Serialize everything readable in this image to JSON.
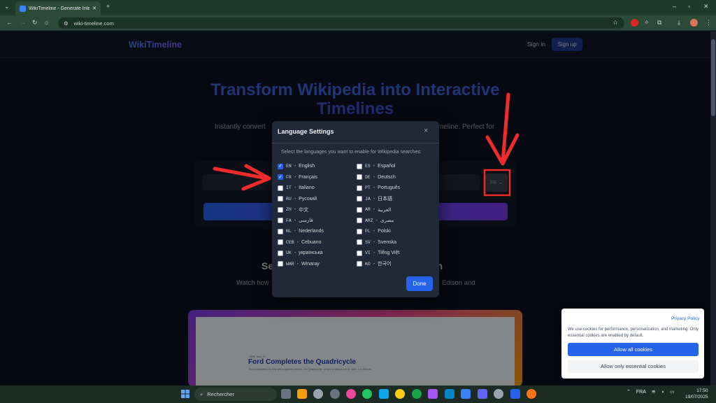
{
  "browser": {
    "tab_title": "WikiTimeline - Generate Interac",
    "url": "wiki-timeline.com",
    "new_tab_label": "+"
  },
  "header": {
    "logo": "WikiTimeline",
    "signin": "Sign in",
    "signup": "Sign up"
  },
  "hero": {
    "line1": "Transform Wikipedia into Interactive",
    "line2": "Timelines",
    "sub_left": "Instantly convert",
    "sub_right": "meline. Perfect for",
    "lang_value": "FR"
  },
  "section": {
    "title_left": "Se",
    "title_right": "on",
    "desc_left": "Watch how",
    "desc_right": "Edison and"
  },
  "demo": {
    "small": "1896 Year 15",
    "title": "Ford Completes the Quadricycle",
    "desc": "Ford completed his first self-propelled vehicle, the Quadricycle, which he test-drove on June 4 in Detroit..."
  },
  "modal": {
    "title": "Language Settings",
    "close": "×",
    "description": "Select the languages you want to enable for Wikipedia searches:",
    "done": "Done",
    "left_options": [
      {
        "code": "EN",
        "name": "English",
        "checked": true
      },
      {
        "code": "FR",
        "name": "Français",
        "checked": true
      },
      {
        "code": "IT",
        "name": "Italiano",
        "checked": false
      },
      {
        "code": "RU",
        "name": "Русский",
        "checked": false
      },
      {
        "code": "ZH",
        "name": "中文",
        "checked": false
      },
      {
        "code": "FA",
        "name": "فارسی",
        "checked": false
      },
      {
        "code": "NL",
        "name": "Nederlands",
        "checked": false
      },
      {
        "code": "CEB",
        "name": "Cebuano",
        "checked": false
      },
      {
        "code": "UK",
        "name": "українська",
        "checked": false
      },
      {
        "code": "WAR",
        "name": "Winaray",
        "checked": false
      }
    ],
    "right_options": [
      {
        "code": "ES",
        "name": "Español",
        "checked": false
      },
      {
        "code": "DE",
        "name": "Deutsch",
        "checked": false
      },
      {
        "code": "PT",
        "name": "Português",
        "checked": false
      },
      {
        "code": "JA",
        "name": "日本語",
        "checked": false
      },
      {
        "code": "AR",
        "name": "العربية",
        "checked": false
      },
      {
        "code": "ARZ",
        "name": "مصرى",
        "checked": false
      },
      {
        "code": "PL",
        "name": "Polski",
        "checked": false
      },
      {
        "code": "SV",
        "name": "Svenska",
        "checked": false
      },
      {
        "code": "VI",
        "name": "Tiếng Việt",
        "checked": false
      },
      {
        "code": "KO",
        "name": "한국어",
        "checked": false
      }
    ]
  },
  "cookie": {
    "privacy": "Privacy Policy",
    "text": "We use cookies for performance, personalization, and marketing. Only essential cookies are enabled by default.",
    "allow_all": "Allow all cookies",
    "allow_essential": "Allow only essential cookies"
  },
  "taskbar": {
    "search": "Rechercher",
    "lang": "FRA",
    "time": "17:50",
    "date": "19/07/2025"
  },
  "colors": {
    "accent": "#2563eb",
    "annotation": "#ef2b2b"
  }
}
